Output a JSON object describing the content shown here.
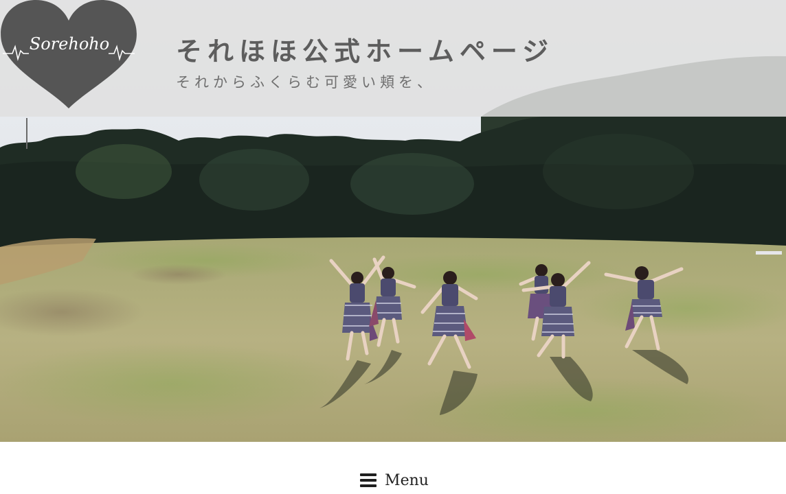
{
  "header": {
    "logo_text": "Sorehoho",
    "title": "それほほ公式ホームページ",
    "tagline": "それからふくらむ可愛い頬を、"
  },
  "hero": {
    "image_alt_icon": "dance-photo",
    "colors": {
      "sky": "#e9ebef",
      "trees": "#1d2a22",
      "grass": "#b2ad7c",
      "costume": "#4b4a6e"
    }
  },
  "nav": {
    "menu_label": "Menu",
    "menu_icon": "hamburger-icon"
  },
  "colors": {
    "header_band": "#e0e0e0",
    "logo_heart": "#555555",
    "title_text": "#5d5d5d"
  }
}
